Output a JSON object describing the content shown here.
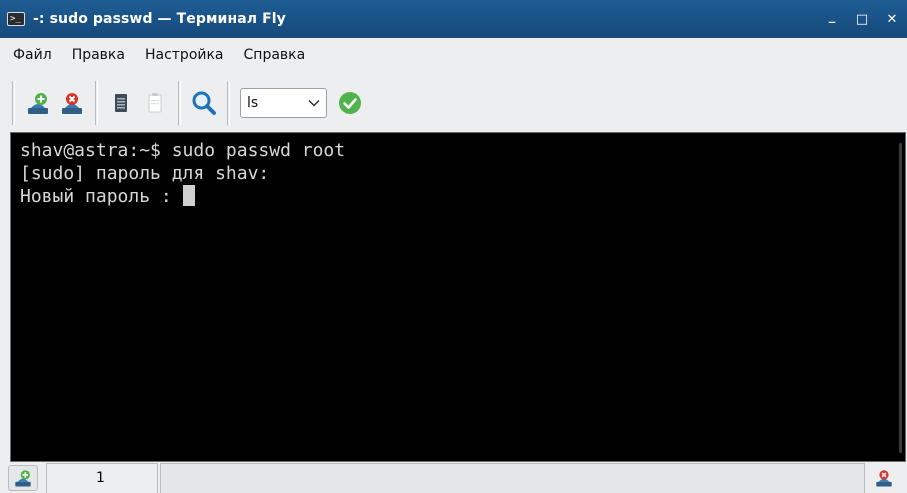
{
  "window": {
    "title": "-: sudo passwd — Терминал Fly",
    "icon": "terminal-icon",
    "controls": [
      "minimize-icon",
      "maximize-icon",
      "close-icon"
    ]
  },
  "menu": {
    "items": [
      "Файл",
      "Правка",
      "Настройка",
      "Справка"
    ]
  },
  "toolbar": {
    "buttons": [
      "new-session-icon",
      "close-session-icon",
      "copy-icon",
      "paste-icon",
      "search-icon"
    ],
    "command_combo_value": "ls",
    "run_icon": "check-icon"
  },
  "terminal": {
    "lines": [
      "shav@astra:~$ sudo passwd root",
      "[sudo] пароль для shav:",
      "Новый пароль : "
    ]
  },
  "statusbar": {
    "tab_label": "1"
  },
  "colors": {
    "title_bg": "#1a5488",
    "terminal_bg": "#000000",
    "terminal_fg": "#d8d8d8",
    "accent_green": "#4fb24a",
    "accent_red": "#d9342b"
  }
}
